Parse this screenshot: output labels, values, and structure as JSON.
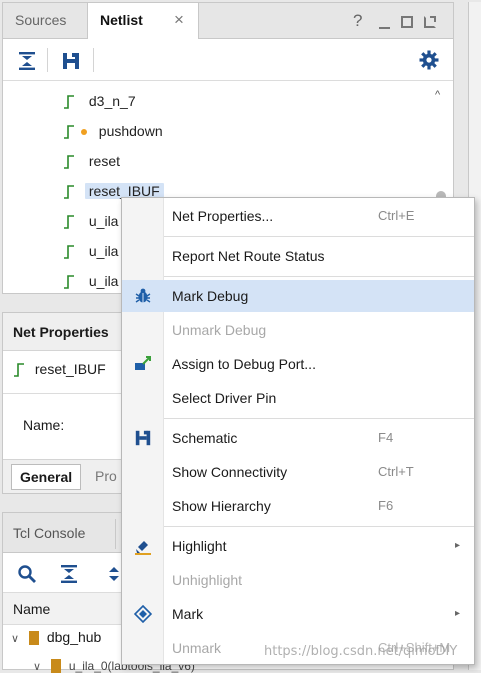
{
  "top_panel": {
    "tabs": [
      {
        "label": "Sources",
        "active": false
      },
      {
        "label": "Netlist",
        "active": true
      }
    ],
    "close_glyph": "×",
    "help_glyph": "?",
    "window_controls": [
      "minimize-icon",
      "maximize-icon",
      "float-icon"
    ],
    "toolbar_icons": [
      "collapse-all-icon",
      "schematic-icon",
      "gear-icon"
    ],
    "tree": [
      {
        "label": "d3_n_7",
        "selected": false
      },
      {
        "label": "pushdown",
        "selected": false,
        "marker": "dot"
      },
      {
        "label": "reset",
        "selected": false
      },
      {
        "label": "reset_IBUF",
        "selected": true
      },
      {
        "label": "u_ila",
        "selected": false
      },
      {
        "label": "u_ila",
        "selected": false
      },
      {
        "label": "u_ila",
        "selected": false
      }
    ]
  },
  "net_properties": {
    "title": "Net Properties",
    "net_name": "reset_IBUF",
    "name_label": "Name:",
    "tabs": [
      {
        "label": "General",
        "active": true
      },
      {
        "label": "Pro",
        "active": false
      }
    ]
  },
  "tcl_panel": {
    "tab": "Tcl Console",
    "column_header": "Name",
    "rows": [
      {
        "label": "dbg_hub"
      },
      {
        "label": "u_ila_0(labtools_ila_v6)"
      }
    ]
  },
  "context_menu": {
    "items": [
      {
        "label": "Net Properties...",
        "shortcut": "Ctrl+E",
        "icon": "",
        "disabled": false,
        "highlighted": false,
        "submenu": false
      },
      {
        "label": "Report Net Route Status",
        "shortcut": "",
        "icon": "",
        "disabled": false,
        "highlighted": false,
        "submenu": false
      },
      {
        "label": "Mark Debug",
        "shortcut": "",
        "icon": "bug-icon",
        "disabled": false,
        "highlighted": true,
        "submenu": false
      },
      {
        "label": "Unmark Debug",
        "shortcut": "",
        "icon": "",
        "disabled": true,
        "highlighted": false,
        "submenu": false
      },
      {
        "label": "Assign to Debug Port...",
        "shortcut": "",
        "icon": "assign-debug-port-icon",
        "disabled": false,
        "highlighted": false,
        "submenu": false
      },
      {
        "label": "Select Driver Pin",
        "shortcut": "",
        "icon": "",
        "disabled": false,
        "highlighted": false,
        "submenu": false
      },
      {
        "label": "Schematic",
        "shortcut": "F4",
        "icon": "schematic-icon",
        "disabled": false,
        "highlighted": false,
        "submenu": false
      },
      {
        "label": "Show Connectivity",
        "shortcut": "Ctrl+T",
        "icon": "",
        "disabled": false,
        "highlighted": false,
        "submenu": false
      },
      {
        "label": "Show Hierarchy",
        "shortcut": "F6",
        "icon": "",
        "disabled": false,
        "highlighted": false,
        "submenu": false
      },
      {
        "label": "Highlight",
        "shortcut": "",
        "icon": "highlight-icon",
        "disabled": false,
        "highlighted": false,
        "submenu": true
      },
      {
        "label": "Unhighlight",
        "shortcut": "",
        "icon": "",
        "disabled": true,
        "highlighted": false,
        "submenu": false
      },
      {
        "label": "Mark",
        "shortcut": "",
        "icon": "mark-icon",
        "disabled": false,
        "highlighted": false,
        "submenu": true
      },
      {
        "label": "Unmark",
        "shortcut": "Ctrl+Shift+M",
        "icon": "",
        "disabled": true,
        "highlighted": false,
        "submenu": false
      }
    ],
    "submenu_glyph": "▸"
  },
  "watermark": "https://blog.csdn.net/qimoDIY",
  "colors": {
    "selection": "#d4e3f6",
    "net_icon": "#2a8a2a",
    "bug_icon": "#1f5fa8",
    "gear_icon": "#1f4f8f"
  }
}
